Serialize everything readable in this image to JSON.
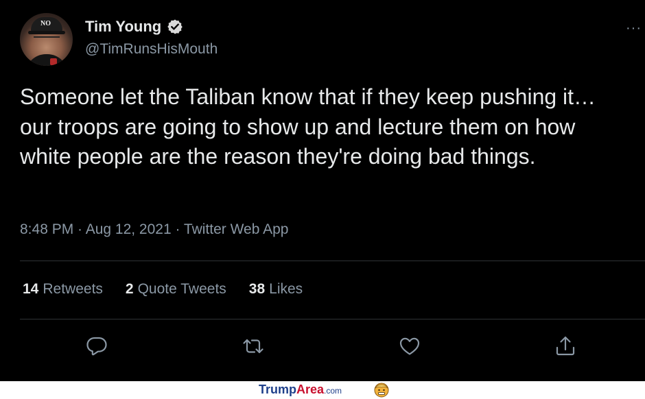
{
  "author": {
    "name": "Tim Young",
    "handle": "@TimRunsHisMouth",
    "cap_text": "NO"
  },
  "tweet": {
    "text": "Someone let the Taliban know that if they keep pushing it… our troops are going to show up and lecture them on how white people are the reason they're doing bad things.",
    "meta": "8:48 PM · Aug 12, 2021 · Twitter Web App"
  },
  "stats": {
    "retweets_count": "14",
    "retweets_label": "Retweets",
    "quotes_count": "2",
    "quotes_label": "Quote Tweets",
    "likes_count": "38",
    "likes_label": "Likes"
  },
  "more_label": "···",
  "watermark": {
    "part1": "Trump",
    "part2": "Area",
    "part3": ".com"
  },
  "colors": {
    "background": "#000000",
    "text_primary": "#e7e9ea",
    "text_secondary": "#8b98a5",
    "verified": "#d9d9d9",
    "divider": "#2f3336"
  }
}
